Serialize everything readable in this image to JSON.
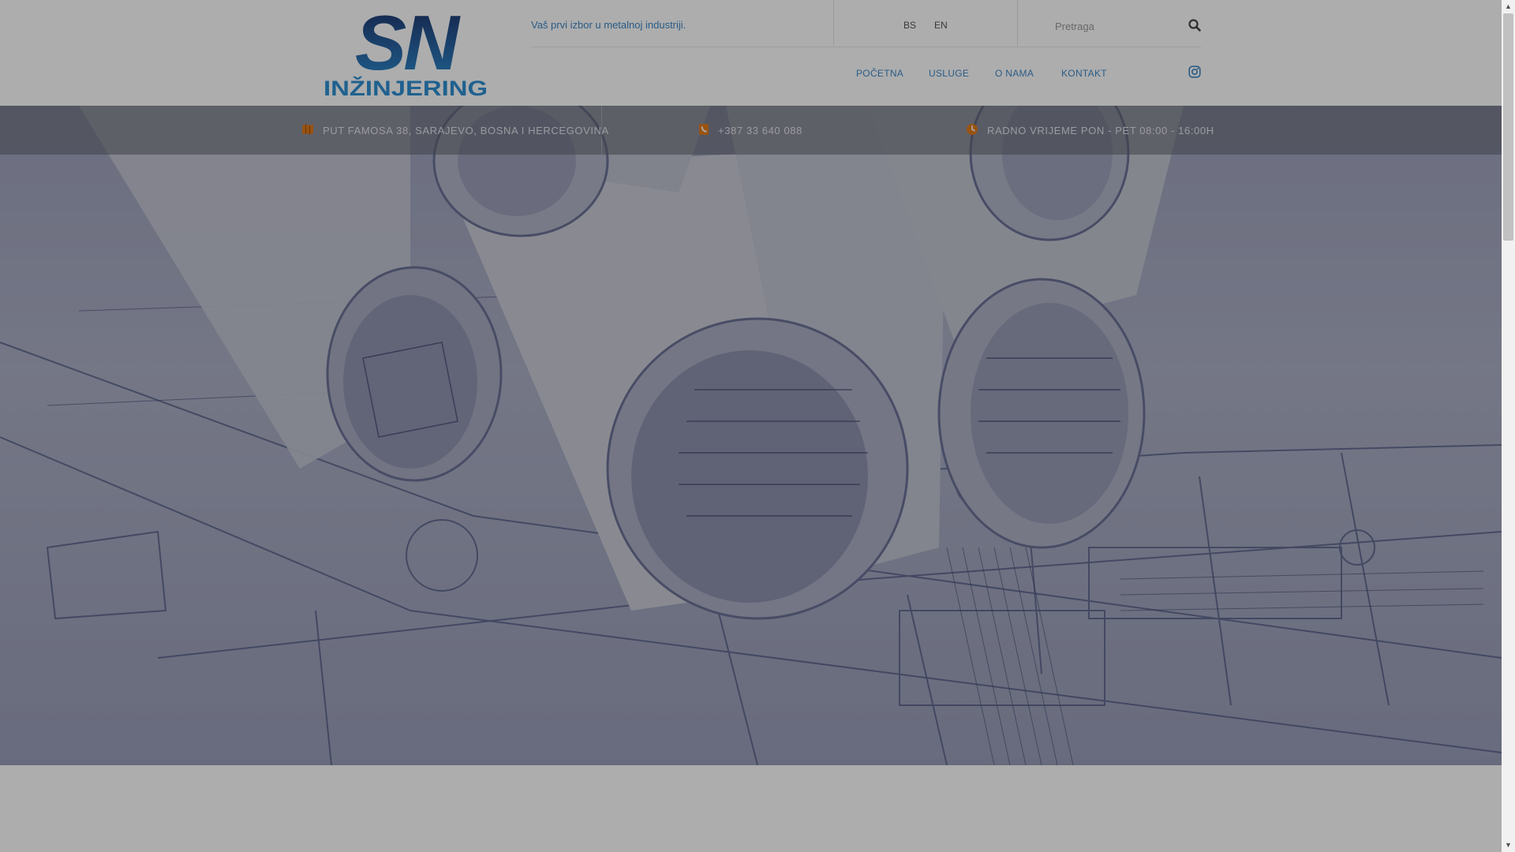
{
  "header": {
    "logo": {
      "name": "SN Inžinjering logo",
      "mark": "SN",
      "wordmark": "INŽINJERING"
    },
    "tagline": "Vaš prvi izbor u metalnoj industriji.",
    "languages": [
      "BS",
      "EN"
    ],
    "search": {
      "placeholder": "Pretraga",
      "icon": "search-icon"
    },
    "nav": [
      "POČETNA",
      "USLUGE",
      "O NAMA",
      "KONTAKT"
    ],
    "social": {
      "icon": "instagram-icon"
    }
  },
  "infobar": {
    "address": {
      "icon": "map-icon",
      "text": "PUT FAMOSA 38, SARAJEVO, BOSNA I HERCEGOVINA"
    },
    "phone": {
      "icon": "phone-icon",
      "text": "+387 33 640 088"
    },
    "hours": {
      "icon": "clock-icon",
      "text": "RADNO VRIJEME PON - PET 08:00 - 16:00H"
    }
  },
  "hero": {
    "image": "architectural-blueprints-photo"
  },
  "colors": {
    "brand_blue": "#3f87c6",
    "logo_dark": "#1c2a5c",
    "logo_light": "#2e8bd0",
    "accent_orange": "#e07b1a",
    "header_bg": "#ffffff"
  },
  "scrollbar": {
    "up_icon": "▲",
    "down_icon": "▼"
  }
}
